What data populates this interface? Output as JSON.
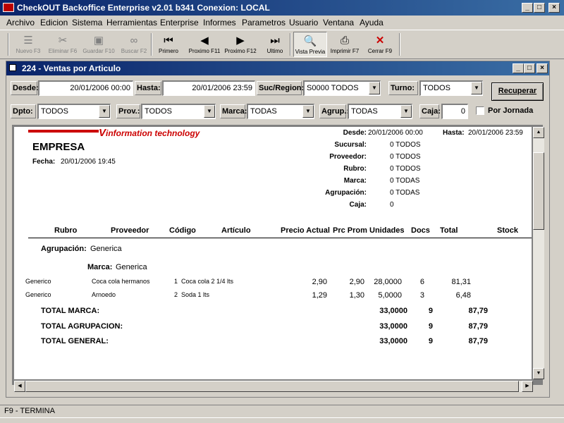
{
  "app": {
    "title": "CheckOUT Backoffice Enterprise v2.01 b341 Conexion: LOCAL"
  },
  "window_controls": {
    "minimize": "_",
    "maximize": "□",
    "close": "×"
  },
  "menu": [
    "Archivo",
    "Edicion",
    "Sistema",
    "Herramientas",
    "Enterprise",
    "Informes",
    "Parametros",
    "Usuario",
    "Ventana",
    "Ayuda"
  ],
  "toolbar": {
    "nuevo": "Nuevo F3",
    "eliminar": "Eliminar F6",
    "guardar": "Guardar F10",
    "buscar": "Buscar F2",
    "primero": "Primero",
    "proximo_f11": "Proximo F11",
    "proximo_f12": "Proximo F12",
    "ultimo": "Ultimo",
    "vista_previa": "Vista Previa",
    "imprimir": "Imprimir F7",
    "cerrar": "Cerrar F9"
  },
  "child": {
    "title": "224 - Ventas por Articulo"
  },
  "filters": {
    "desde_label": "Desde:",
    "desde_value": "20/01/2006 00:00",
    "hasta_label": "Hasta:",
    "hasta_value": "20/01/2006 23:59",
    "suc_label": "Suc/Region:",
    "suc_value": "S0000 TODOS",
    "turno_label": "Turno:",
    "turno_value": "TODOS",
    "recuperar": "Recuperar",
    "dpto_label": "Dpto:",
    "dpto_value": "TODOS",
    "prov_label": "Prov.:",
    "prov_value": "TODOS",
    "marca_label": "Marca:",
    "marca_value": "TODAS",
    "agrup_label": "Agrup.:",
    "agrup_value": "TODAS",
    "caja_label": "Caja:",
    "caja_value": "0",
    "por_jornada": "Por Jornada"
  },
  "report": {
    "logo_text": "information technology",
    "empresa": "EMPRESA",
    "fecha_label": "Fecha:",
    "fecha_value": "20/01/2006 19:45",
    "desde_label": "Desde:",
    "desde_value": "20/01/2006 00:00",
    "hasta_label": "Hasta:",
    "hasta_value": "20/01/2006 23:59",
    "params": [
      {
        "label": "Sucursal:",
        "value": "0 TODOS"
      },
      {
        "label": "Proveedor:",
        "value": "0 TODOS"
      },
      {
        "label": "Rubro:",
        "value": "0 TODOS"
      },
      {
        "label": "Marca:",
        "value": "0 TODAS"
      },
      {
        "label": "Agrupación:",
        "value": "0 TODAS"
      },
      {
        "label": "Caja:",
        "value": "0"
      }
    ],
    "columns": {
      "rubro": "Rubro",
      "proveedor": "Proveedor",
      "codigo": "Código",
      "articulo": "Artículo",
      "precio": "Precio Actual",
      "prc_prom": "Prc Prom",
      "unidades": "Unidades",
      "docs": "Docs",
      "total": "Total",
      "stock": "Stock"
    },
    "agrupacion_label": "Agrupación:",
    "agrupacion_value": "Generica",
    "marca_label": "Marca:",
    "marca_value": "Generica",
    "rows": [
      {
        "rubro": "Generico",
        "proveedor": "Coca cola hermanos",
        "codigo": "1",
        "articulo": "Coca cola 2 1/4 lts",
        "precio": "2,90",
        "prc_prom": "2,90",
        "unidades": "28,0000",
        "docs": "6",
        "total": "81,31"
      },
      {
        "rubro": "Generico",
        "proveedor": "Arnoedo",
        "codigo": "2",
        "articulo": "Soda 1 lts",
        "precio": "1,29",
        "prc_prom": "1,30",
        "unidades": "5,0000",
        "docs": "3",
        "total": "6,48"
      }
    ],
    "totals": [
      {
        "label": "TOTAL MARCA:",
        "unidades": "33,0000",
        "docs": "9",
        "total": "87,79"
      },
      {
        "label": "TOTAL AGRUPACION:",
        "unidades": "33,0000",
        "docs": "9",
        "total": "87,79"
      },
      {
        "label": "TOTAL GENERAL:",
        "unidades": "33,0000",
        "docs": "9",
        "total": "87,79"
      }
    ]
  },
  "status": {
    "text": "F9 - TERMINA"
  },
  "colors": {
    "titlebar": "#0a246a",
    "face": "#d4d0c8",
    "logo_red": "#cc0000",
    "close_red": "#cc0000"
  }
}
